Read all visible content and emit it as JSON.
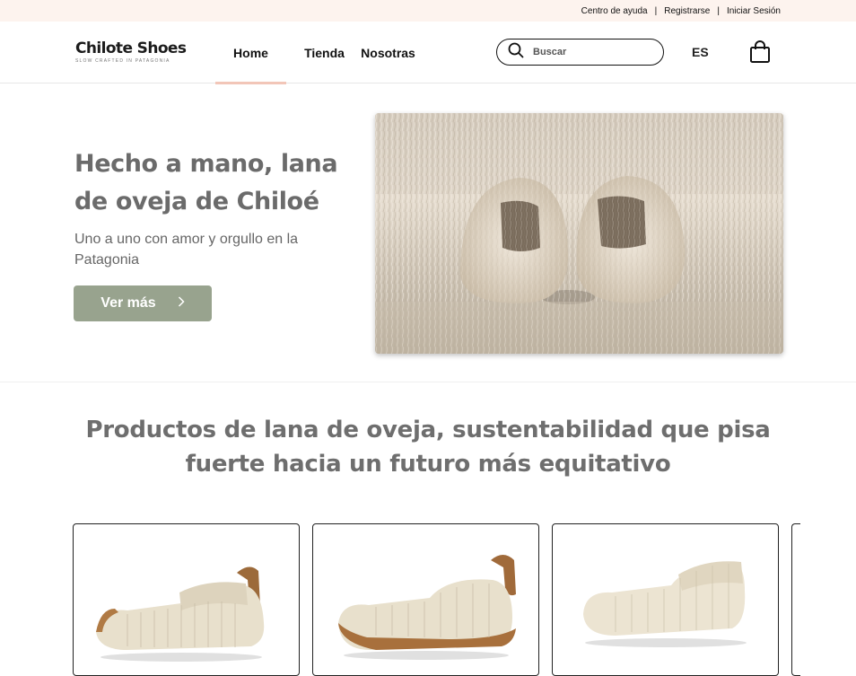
{
  "topbar": {
    "links": [
      "Centro de ayuda",
      "Registrarse",
      "Iniciar Sesión"
    ],
    "separator": "|"
  },
  "header": {
    "logo": "Chilote Shoes",
    "logo_tagline": "SLOW CRAFTED IN PATAGONIA",
    "nav": [
      "Home",
      "Tienda",
      "Nosotras"
    ],
    "active_nav": "Home",
    "search_placeholder": "Buscar",
    "language": "ES"
  },
  "hero": {
    "title": "Hecho a mano, lana de oveja de Chiloé",
    "subtitle": "Uno a uno con amor y orgullo en la Patagonia",
    "cta_label": "Ver más",
    "cta_icon": "chevron-right-icon"
  },
  "products_section": {
    "title": "Productos de lana de oveja, sustentabilidad que pisa fuerte hacia un futuro más equitativo"
  },
  "colors": {
    "topbar_bg": "#fdf3ee",
    "accent_underline": "#f2c6b8",
    "cta_bg": "#98a38e",
    "heading_gray": "#6b6b6b"
  }
}
